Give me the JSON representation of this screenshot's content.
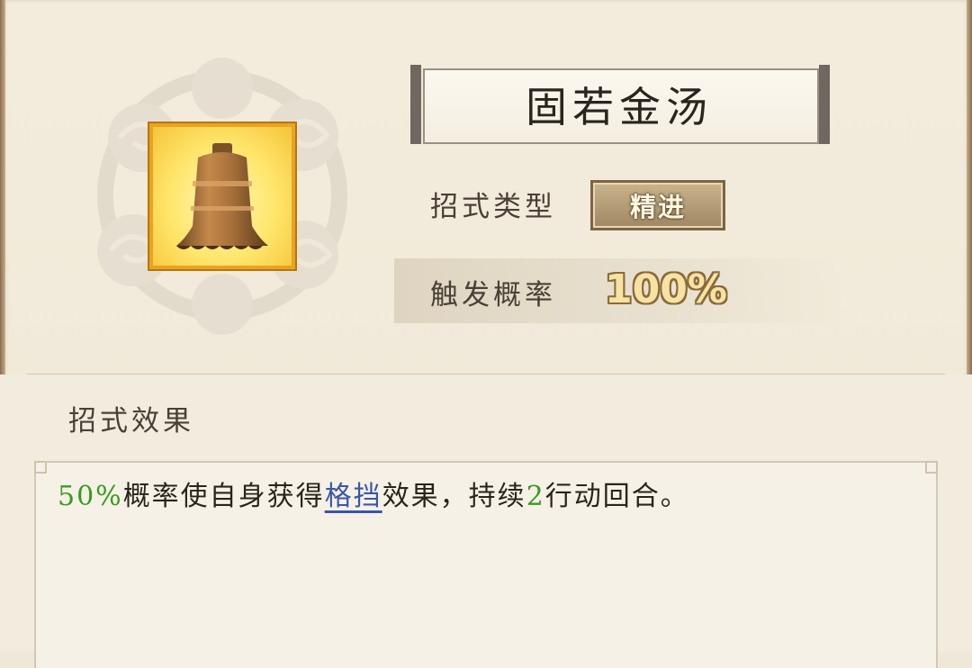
{
  "skill": {
    "name": "固若金汤",
    "icon": "bell-icon",
    "type_label": "招式类型",
    "type_value": "精进",
    "trigger_label": "触发概率",
    "trigger_value": "100%"
  },
  "effects": {
    "heading": "招式效果",
    "parts": {
      "p1": "50%",
      "p2": "概率使自身获得",
      "p3": "格挡",
      "p4": "效果，持续",
      "p5": "2",
      "p6": "行动回合。"
    }
  },
  "colors": {
    "background": "#efe8d9",
    "highlight_green": "#3a9a22",
    "link_blue": "#3a57a8",
    "icon_frame": "#e9a31f",
    "trigger_value_fill": "#f6e2a3"
  }
}
